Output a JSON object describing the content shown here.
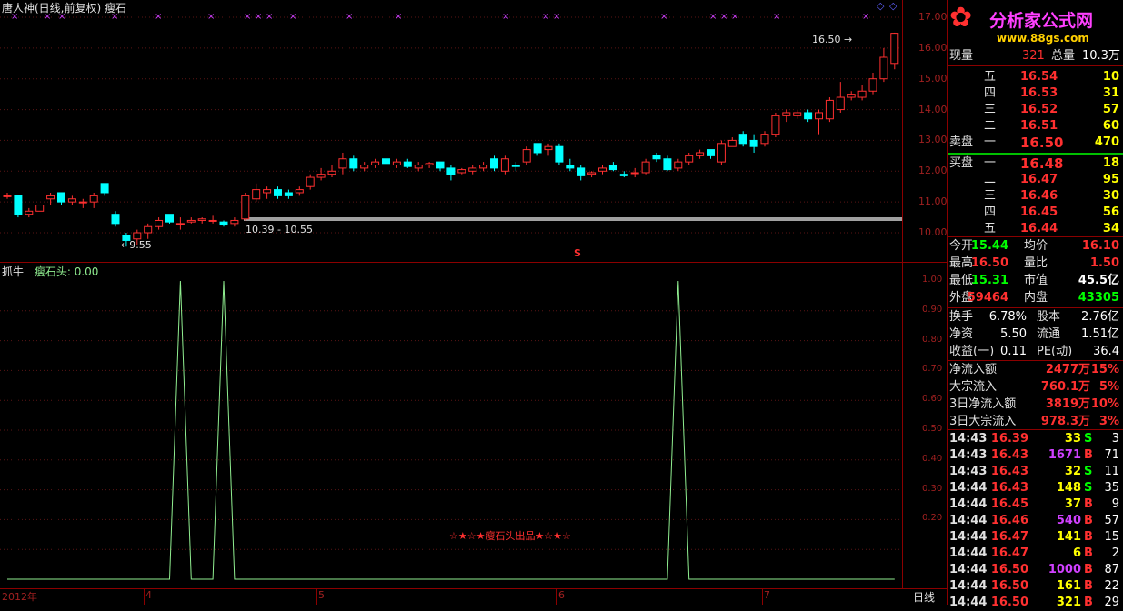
{
  "main_chart": {
    "title": "唐人神(日线,前复权)",
    "indicator_name": "瘦石",
    "price_ticks": [
      "17.00",
      "16.00",
      "15.00",
      "14.00",
      "13.00",
      "12.00",
      "11.00",
      "10.00"
    ],
    "high_annotation": "16.50",
    "low_annotation": "9.55",
    "range_annotation": "10.39 - 10.55",
    "marker": "S"
  },
  "indicator_panel": {
    "name": "抓牛",
    "series_label": "瘦石头: 0.00",
    "ticks": [
      "1.00",
      "0.90",
      "0.80",
      "0.70",
      "0.60",
      "0.50",
      "0.40",
      "0.30",
      "0.20"
    ],
    "watermark": "☆★☆★瘦石头出品★☆★☆"
  },
  "x_axis": {
    "labels": [
      "2012年",
      "4",
      "5",
      "6",
      "7"
    ],
    "period_button": "日线"
  },
  "logo": {
    "name": "分析家公式网",
    "url": "www.88gs.com"
  },
  "quote": {
    "now_vol_label": "现量",
    "now_vol": "321",
    "total_vol_label": "总量",
    "total_vol": "10.3万",
    "sell_label": "卖盘",
    "buy_label": "买盘",
    "sells": [
      {
        "lv": "五",
        "price": "16.54",
        "vol": "10"
      },
      {
        "lv": "四",
        "price": "16.53",
        "vol": "31"
      },
      {
        "lv": "三",
        "price": "16.52",
        "vol": "57"
      },
      {
        "lv": "二",
        "price": "16.51",
        "vol": "60"
      },
      {
        "lv": "一",
        "price": "16.50",
        "vol": "470"
      }
    ],
    "buys": [
      {
        "lv": "一",
        "price": "16.48",
        "vol": "18"
      },
      {
        "lv": "二",
        "price": "16.47",
        "vol": "95"
      },
      {
        "lv": "三",
        "price": "16.46",
        "vol": "30"
      },
      {
        "lv": "四",
        "price": "16.45",
        "vol": "56"
      },
      {
        "lv": "五",
        "price": "16.44",
        "vol": "34"
      }
    ],
    "stats": [
      {
        "l1": "今开",
        "v1": "15.44",
        "c1": "green",
        "l2": "均价",
        "v2": "16.10",
        "c2": "red"
      },
      {
        "l1": "最高",
        "v1": "16.50",
        "c1": "red",
        "l2": "量比",
        "v2": "1.50",
        "c2": "red"
      },
      {
        "l1": "最低",
        "v1": "15.31",
        "c1": "green",
        "l2": "市值",
        "v2": "45.5亿",
        "c2": "white"
      },
      {
        "l1": "外盘",
        "v1": "59464",
        "c1": "red",
        "l2": "内盘",
        "v2": "43305",
        "c2": "green"
      }
    ],
    "stats2": [
      {
        "l1": "换手",
        "v1": "6.78%",
        "l2": "股本",
        "v2": "2.76亿"
      },
      {
        "l1": "净资",
        "v1": "5.50",
        "l2": "流通",
        "v2": "1.51亿"
      },
      {
        "l1": "收益(一)",
        "v1": "0.11",
        "l2": "PE(动)",
        "v2": "36.4"
      }
    ],
    "flows": [
      {
        "label": "净流入额",
        "value": "2477万",
        "pct": "15%"
      },
      {
        "label": "大宗流入",
        "value": "760.1万",
        "pct": "5%"
      },
      {
        "label": "3日净流入额",
        "value": "3819万",
        "pct": "10%"
      },
      {
        "label": "3日大宗流入",
        "value": "978.3万",
        "pct": "3%"
      }
    ],
    "ticks": [
      {
        "t": "14:43",
        "p": "16.39",
        "v": "33",
        "vc": "yellow",
        "bs": "S",
        "n": "3"
      },
      {
        "t": "14:43",
        "p": "16.43",
        "v": "1671",
        "vc": "purple",
        "bs": "B",
        "n": "71"
      },
      {
        "t": "14:43",
        "p": "16.43",
        "v": "32",
        "vc": "yellow",
        "bs": "S",
        "n": "11"
      },
      {
        "t": "14:44",
        "p": "16.43",
        "v": "148",
        "vc": "yellow",
        "bs": "S",
        "n": "35"
      },
      {
        "t": "14:44",
        "p": "16.45",
        "v": "37",
        "vc": "yellow",
        "bs": "B",
        "n": "9"
      },
      {
        "t": "14:44",
        "p": "16.46",
        "v": "540",
        "vc": "purple",
        "bs": "B",
        "n": "57"
      },
      {
        "t": "14:44",
        "p": "16.47",
        "v": "141",
        "vc": "yellow",
        "bs": "B",
        "n": "15"
      },
      {
        "t": "14:44",
        "p": "16.47",
        "v": "6",
        "vc": "yellow",
        "bs": "B",
        "n": "2"
      },
      {
        "t": "14:44",
        "p": "16.50",
        "v": "1000",
        "vc": "purple",
        "bs": "B",
        "n": "87"
      },
      {
        "t": "14:44",
        "p": "16.50",
        "v": "161",
        "vc": "yellow",
        "bs": "B",
        "n": "22"
      },
      {
        "t": "14:44",
        "p": "16.50",
        "v": "321",
        "vc": "yellow",
        "bs": "B",
        "n": "29"
      }
    ]
  },
  "chart_data": {
    "type": "candlestick",
    "ylim": [
      9.5,
      17.0
    ],
    "candles": [
      [
        11.2,
        11.3,
        11.1,
        11.2
      ],
      [
        11.2,
        11.2,
        10.5,
        10.6
      ],
      [
        10.6,
        10.8,
        10.5,
        10.7
      ],
      [
        10.7,
        10.9,
        10.7,
        10.9
      ],
      [
        11.1,
        11.3,
        10.9,
        11.2
      ],
      [
        11.3,
        11.3,
        10.9,
        11.0
      ],
      [
        11.0,
        11.2,
        10.9,
        11.1
      ],
      [
        11.0,
        11.1,
        10.8,
        11.0
      ],
      [
        11.0,
        11.3,
        10.8,
        11.2
      ],
      [
        11.6,
        11.6,
        11.2,
        11.3
      ],
      [
        10.6,
        10.7,
        10.2,
        10.3
      ],
      [
        9.9,
        10.0,
        9.55,
        9.75
      ],
      [
        9.8,
        10.1,
        9.6,
        10.0
      ],
      [
        10.0,
        10.3,
        9.8,
        10.2
      ],
      [
        10.2,
        10.5,
        10.1,
        10.4
      ],
      [
        10.6,
        10.6,
        10.3,
        10.35
      ],
      [
        10.3,
        10.5,
        10.1,
        10.3
      ],
      [
        10.35,
        10.5,
        10.3,
        10.4
      ],
      [
        10.4,
        10.5,
        10.3,
        10.45
      ],
      [
        10.4,
        10.55,
        10.3,
        10.4
      ],
      [
        10.35,
        10.4,
        10.2,
        10.25
      ],
      [
        10.3,
        10.5,
        10.2,
        10.4
      ],
      [
        10.45,
        11.3,
        10.4,
        11.2
      ],
      [
        11.1,
        11.6,
        11.0,
        11.4
      ],
      [
        11.3,
        11.5,
        11.1,
        11.4
      ],
      [
        11.4,
        11.5,
        11.1,
        11.2
      ],
      [
        11.3,
        11.4,
        11.1,
        11.2
      ],
      [
        11.3,
        11.5,
        11.2,
        11.4
      ],
      [
        11.5,
        11.9,
        11.4,
        11.8
      ],
      [
        11.8,
        12.1,
        11.7,
        11.9
      ],
      [
        11.9,
        12.2,
        11.8,
        12.0
      ],
      [
        12.1,
        12.6,
        11.9,
        12.4
      ],
      [
        12.4,
        12.5,
        12.0,
        12.1
      ],
      [
        12.1,
        12.3,
        12.0,
        12.2
      ],
      [
        12.2,
        12.4,
        12.1,
        12.3
      ],
      [
        12.4,
        12.4,
        12.2,
        12.25
      ],
      [
        12.2,
        12.4,
        12.1,
        12.3
      ],
      [
        12.3,
        12.4,
        12.1,
        12.15
      ],
      [
        12.1,
        12.3,
        12.0,
        12.2
      ],
      [
        12.2,
        12.3,
        12.1,
        12.25
      ],
      [
        12.3,
        12.3,
        12.0,
        12.1
      ],
      [
        12.1,
        12.2,
        11.7,
        11.9
      ],
      [
        11.95,
        12.1,
        11.9,
        12.05
      ],
      [
        12.0,
        12.2,
        11.9,
        12.1
      ],
      [
        12.1,
        12.3,
        12.0,
        12.2
      ],
      [
        12.4,
        12.5,
        12.0,
        12.1
      ],
      [
        12.0,
        12.5,
        11.9,
        12.4
      ],
      [
        12.2,
        12.3,
        12.0,
        12.15
      ],
      [
        12.3,
        12.8,
        12.2,
        12.7
      ],
      [
        12.9,
        12.9,
        12.5,
        12.6
      ],
      [
        12.7,
        12.9,
        12.5,
        12.8
      ],
      [
        12.8,
        12.9,
        12.2,
        12.3
      ],
      [
        12.2,
        12.4,
        12.0,
        12.1
      ],
      [
        12.1,
        12.2,
        11.7,
        11.85
      ],
      [
        11.9,
        12.0,
        11.8,
        11.95
      ],
      [
        12.0,
        12.2,
        11.9,
        12.1
      ],
      [
        12.2,
        12.3,
        12.0,
        12.05
      ],
      [
        11.9,
        12.0,
        11.8,
        11.85
      ],
      [
        11.95,
        12.1,
        11.8,
        11.95
      ],
      [
        11.95,
        12.4,
        11.9,
        12.3
      ],
      [
        12.5,
        12.6,
        12.3,
        12.4
      ],
      [
        12.4,
        12.5,
        12.0,
        12.05
      ],
      [
        12.1,
        12.4,
        12.0,
        12.3
      ],
      [
        12.3,
        12.6,
        12.2,
        12.5
      ],
      [
        12.5,
        12.7,
        12.4,
        12.6
      ],
      [
        12.7,
        12.7,
        12.4,
        12.5
      ],
      [
        12.3,
        13.0,
        12.2,
        12.9
      ],
      [
        12.8,
        13.1,
        12.8,
        13.0
      ],
      [
        13.2,
        13.3,
        12.8,
        12.9
      ],
      [
        13.0,
        13.2,
        12.6,
        12.8
      ],
      [
        12.9,
        13.3,
        12.8,
        13.2
      ],
      [
        13.2,
        13.9,
        13.1,
        13.8
      ],
      [
        13.8,
        14.0,
        13.6,
        13.9
      ],
      [
        13.8,
        14.0,
        13.7,
        13.9
      ],
      [
        13.9,
        14.0,
        13.6,
        13.7
      ],
      [
        13.7,
        14.0,
        13.2,
        13.9
      ],
      [
        13.7,
        14.4,
        13.6,
        14.3
      ],
      [
        14.0,
        14.9,
        13.9,
        14.4
      ],
      [
        14.4,
        14.6,
        14.3,
        14.5
      ],
      [
        14.4,
        14.8,
        14.3,
        14.6
      ],
      [
        14.6,
        15.2,
        14.5,
        15.0
      ],
      [
        15.0,
        16.0,
        14.9,
        15.7
      ],
      [
        15.5,
        16.5,
        15.31,
        16.48
      ]
    ],
    "indicator": [
      0,
      0,
      0,
      0,
      0,
      0,
      0,
      0,
      0,
      0,
      0,
      0,
      0,
      0,
      0,
      0,
      1,
      0,
      0,
      0,
      1,
      0,
      0,
      0,
      0,
      0,
      0,
      0,
      0,
      0,
      0,
      0,
      0,
      0,
      0,
      0,
      0,
      0,
      0,
      0,
      0,
      0,
      0,
      0,
      0,
      0,
      0,
      0,
      0,
      0,
      0,
      0,
      0,
      0,
      0,
      0,
      0,
      0,
      0,
      0,
      0,
      0,
      1,
      0,
      0,
      0,
      0,
      0,
      0,
      0,
      0,
      0,
      0,
      0,
      0,
      0,
      0,
      0,
      0,
      0,
      0,
      0,
      0
    ],
    "indicator_ylim": [
      0,
      1.0
    ]
  }
}
